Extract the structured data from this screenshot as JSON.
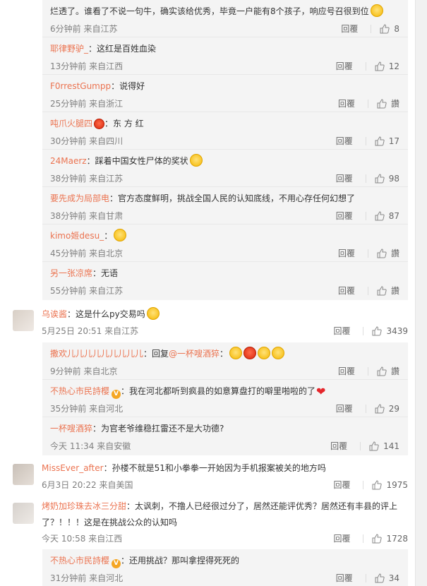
{
  "comments_top_partial": {
    "text": "烂透了。谁看了不说一句牛，确实该给优秀，毕竟一户能有8个孩子，响应号召很到位",
    "meta": "6分钟前 来自江苏",
    "reply_label": "回覆",
    "likes": "8"
  },
  "thread1_replies": [
    {
      "user": "耶律野驴_",
      "text": "：这红是百姓血染",
      "meta": "13分钟前 来自江西",
      "reply_label": "回覆",
      "likes": "12"
    },
    {
      "user": "F0rrestGumpp",
      "text": "：说得好",
      "meta": "25分钟前 来自浙江",
      "reply_label": "回覆",
      "likes": "讚"
    },
    {
      "user": "吨爪火腿四",
      "text": "：东 方 红",
      "meta": "30分钟前 来自四川",
      "reply_label": "回覆",
      "likes": "17"
    },
    {
      "user": "24Maerz",
      "text": "：踩着中国女性尸体的奖状",
      "meta": "38分钟前 来自江苏",
      "reply_label": "回覆",
      "likes": "98"
    },
    {
      "user": "要先成为局部电",
      "text": "：官方态度鲜明，挑战全国人民的认知底线，不用心存任何幻想了",
      "meta": "38分钟前 来自甘肃",
      "reply_label": "回覆",
      "likes": "87"
    },
    {
      "user": "kimo姬desu_",
      "text": "：",
      "meta": "45分钟前 来自北京",
      "reply_label": "回覆",
      "likes": "讚"
    },
    {
      "user": "另一张凉席",
      "text": "：无语",
      "meta": "55分钟前 来自江苏",
      "reply_label": "回覆",
      "likes": "讚"
    }
  ],
  "comment2": {
    "user": "乌诶酱",
    "text": "：这是什么py交易吗",
    "meta": "5月25日 20:51 来自江苏",
    "reply_label": "回覆",
    "likes": "3439"
  },
  "thread2_replies": [
    {
      "user": "撒欢儿儿儿儿儿儿儿儿儿",
      "text": "：回复",
      "mention": "@一杯嗖酒猝",
      "text2": "：",
      "meta": "9分钟前 来自北京",
      "reply_label": "回覆",
      "likes": "讚"
    },
    {
      "user": "不热心市民詩樱",
      "text": "：我在河北都听到疯县的如意算盘打的噼里啪啦的了",
      "meta": "35分钟前 来自河北",
      "reply_label": "回覆",
      "likes": "29"
    },
    {
      "user": "一杯嗖酒猝",
      "text": "：为官老爷维稳扛雷还不是大功德?",
      "meta": "今天 11:34 来自安徽",
      "reply_label": "回覆",
      "likes": "141"
    }
  ],
  "comment3": {
    "user": "MissEver_after",
    "text": "：孙楼不就是51和小拳拳一开始因为手机报案被关的地方吗",
    "meta": "6月3日 20:22 来自美国",
    "reply_label": "回覆",
    "likes": "1975"
  },
  "comment4": {
    "user": "烤奶加珍珠去冰三分甜",
    "text": "：太讽刺，不撸人已经很过分了，居然还能评优秀？居然还有丰县的评上了？！！！这是在挑战公众的认知吗",
    "meta": "今天 10:58 来自江西",
    "reply_label": "回覆",
    "likes": "1728"
  },
  "thread4_replies": [
    {
      "user": "不热心市民詩樱",
      "text": "：还用挑战？那叫拿捏得死死的",
      "meta": "31分钟前 来自河北",
      "reply_label": "回覆",
      "likes": "34"
    }
  ],
  "colors": {
    "username": "#eb7350",
    "meta": "#808080",
    "reply_bg": "#f4f4f4"
  }
}
